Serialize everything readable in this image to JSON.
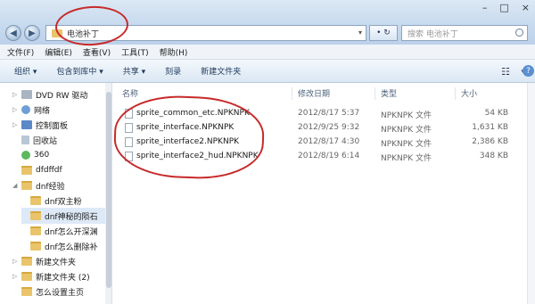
{
  "window": {
    "controls": [
      "–",
      "□",
      "×"
    ]
  },
  "address": {
    "path": "电池补丁",
    "refresh_label": "• ↻",
    "search_placeholder": "搜索 电池补丁"
  },
  "menu": [
    "文件(F)",
    "编辑(E)",
    "查看(V)",
    "工具(T)",
    "帮助(H)"
  ],
  "toolbar": {
    "organize": "组织 ▾",
    "include_in_library": "包含到库中 ▾",
    "share": "共享 ▾",
    "burn": "刻录",
    "new_folder": "新建文件夹",
    "view_icon": "☷",
    "more": "▾",
    "help": "?"
  },
  "nav": {
    "items": [
      {
        "label": "DVD RW 驱动",
        "arrow": "▷",
        "icon": "drive"
      },
      {
        "label": "网络",
        "arrow": "▷",
        "icon": "net"
      },
      {
        "label": "控制面板",
        "arrow": "▷",
        "icon": "cp"
      },
      {
        "label": "回收站",
        "arrow": "",
        "icon": "bin"
      },
      {
        "label": "360",
        "arrow": "",
        "icon": "app"
      },
      {
        "label": "dfdffdf",
        "arrow": "",
        "icon": "folder"
      },
      {
        "label": "dnf经验",
        "arrow": "◢",
        "icon": "folder"
      },
      {
        "label": "dnf双主粉",
        "arrow": "",
        "icon": "folder"
      },
      {
        "label": "dnf神秘的陨石",
        "arrow": "",
        "icon": "folder"
      },
      {
        "label": "dnf怎么开深渊",
        "arrow": "",
        "icon": "folder"
      },
      {
        "label": "dnf怎么删除补",
        "arrow": "",
        "icon": "folder"
      },
      {
        "label": "新建文件夹",
        "arrow": "▷",
        "icon": "folder"
      },
      {
        "label": "新建文件夹 (2)",
        "arrow": "▷",
        "icon": "folder"
      },
      {
        "label": "怎么设置主页",
        "arrow": "",
        "icon": "folder"
      }
    ]
  },
  "columns": {
    "name": "名称",
    "date": "修改日期",
    "type": "类型",
    "size": "大小"
  },
  "files": [
    {
      "name": "sprite_common_etc.NPKNPK",
      "date": "2012/8/17 5:37",
      "type": "NPKNPK 文件",
      "size": "54 KB"
    },
    {
      "name": "sprite_interface.NPKNPK",
      "date": "2012/9/25 9:32",
      "type": "NPKNPK 文件",
      "size": "1,631 KB"
    },
    {
      "name": "sprite_interface2.NPKNPK",
      "date": "2012/8/17 4:30",
      "type": "NPKNPK 文件",
      "size": "2,386 KB"
    },
    {
      "name": "sprite_interface2_hud.NPKNPK",
      "date": "2012/8/19 6:14",
      "type": "NPKNPK 文件",
      "size": "348 KB"
    }
  ],
  "colors": {
    "annotation_red": "#c72a2a",
    "folder": "#e9c46a",
    "selection": "#dde9f7"
  }
}
